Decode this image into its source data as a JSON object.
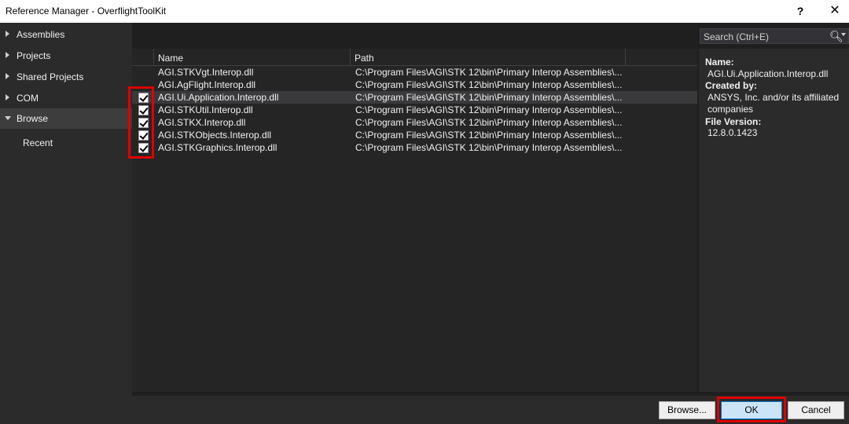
{
  "window": {
    "title": "Reference Manager - OverflightToolKit",
    "help_label": "?",
    "close_label": "✕"
  },
  "sidebar": {
    "items": [
      {
        "label": "Assemblies"
      },
      {
        "label": "Projects"
      },
      {
        "label": "Shared Projects"
      },
      {
        "label": "COM"
      },
      {
        "label": "Browse"
      }
    ],
    "sub_item": "Recent"
  },
  "search": {
    "placeholder": "Search (Ctrl+E)"
  },
  "table": {
    "columns": [
      "Name",
      "Path"
    ],
    "rows": [
      {
        "checked": false,
        "name": "AGI.STKVgt.Interop.dll",
        "path": "C:\\Program Files\\AGI\\STK 12\\bin\\Primary Interop Assemblies\\..."
      },
      {
        "checked": false,
        "name": "AGI.AgFlight.Interop.dll",
        "path": "C:\\Program Files\\AGI\\STK 12\\bin\\Primary Interop Assemblies\\..."
      },
      {
        "checked": true,
        "name": "AGI.Ui.Application.Interop.dll",
        "path": "C:\\Program Files\\AGI\\STK 12\\bin\\Primary Interop Assemblies\\..."
      },
      {
        "checked": true,
        "name": "AGI.STKUtil.Interop.dll",
        "path": "C:\\Program Files\\AGI\\STK 12\\bin\\Primary Interop Assemblies\\..."
      },
      {
        "checked": true,
        "name": "AGI.STKX.Interop.dll",
        "path": "C:\\Program Files\\AGI\\STK 12\\bin\\Primary Interop Assemblies\\..."
      },
      {
        "checked": true,
        "name": "AGI.STKObjects.Interop.dll",
        "path": "C:\\Program Files\\AGI\\STK 12\\bin\\Primary Interop Assemblies\\..."
      },
      {
        "checked": true,
        "name": "AGI.STKGraphics.Interop.dll",
        "path": "C:\\Program Files\\AGI\\STK 12\\bin\\Primary Interop Assemblies\\..."
      }
    ]
  },
  "details": {
    "name_label": "Name:",
    "name_value": "AGI.Ui.Application.Interop.dll",
    "created_label": "Created by:",
    "created_value": "ANSYS, Inc. and/or its affiliated companies",
    "version_label": "File Version:",
    "version_value": "12.8.0.1423"
  },
  "buttons": {
    "browse": "Browse...",
    "ok": "OK",
    "cancel": "Cancel"
  },
  "colors": {
    "highlight": "#e00000",
    "ok_accent": "#0078d7"
  }
}
